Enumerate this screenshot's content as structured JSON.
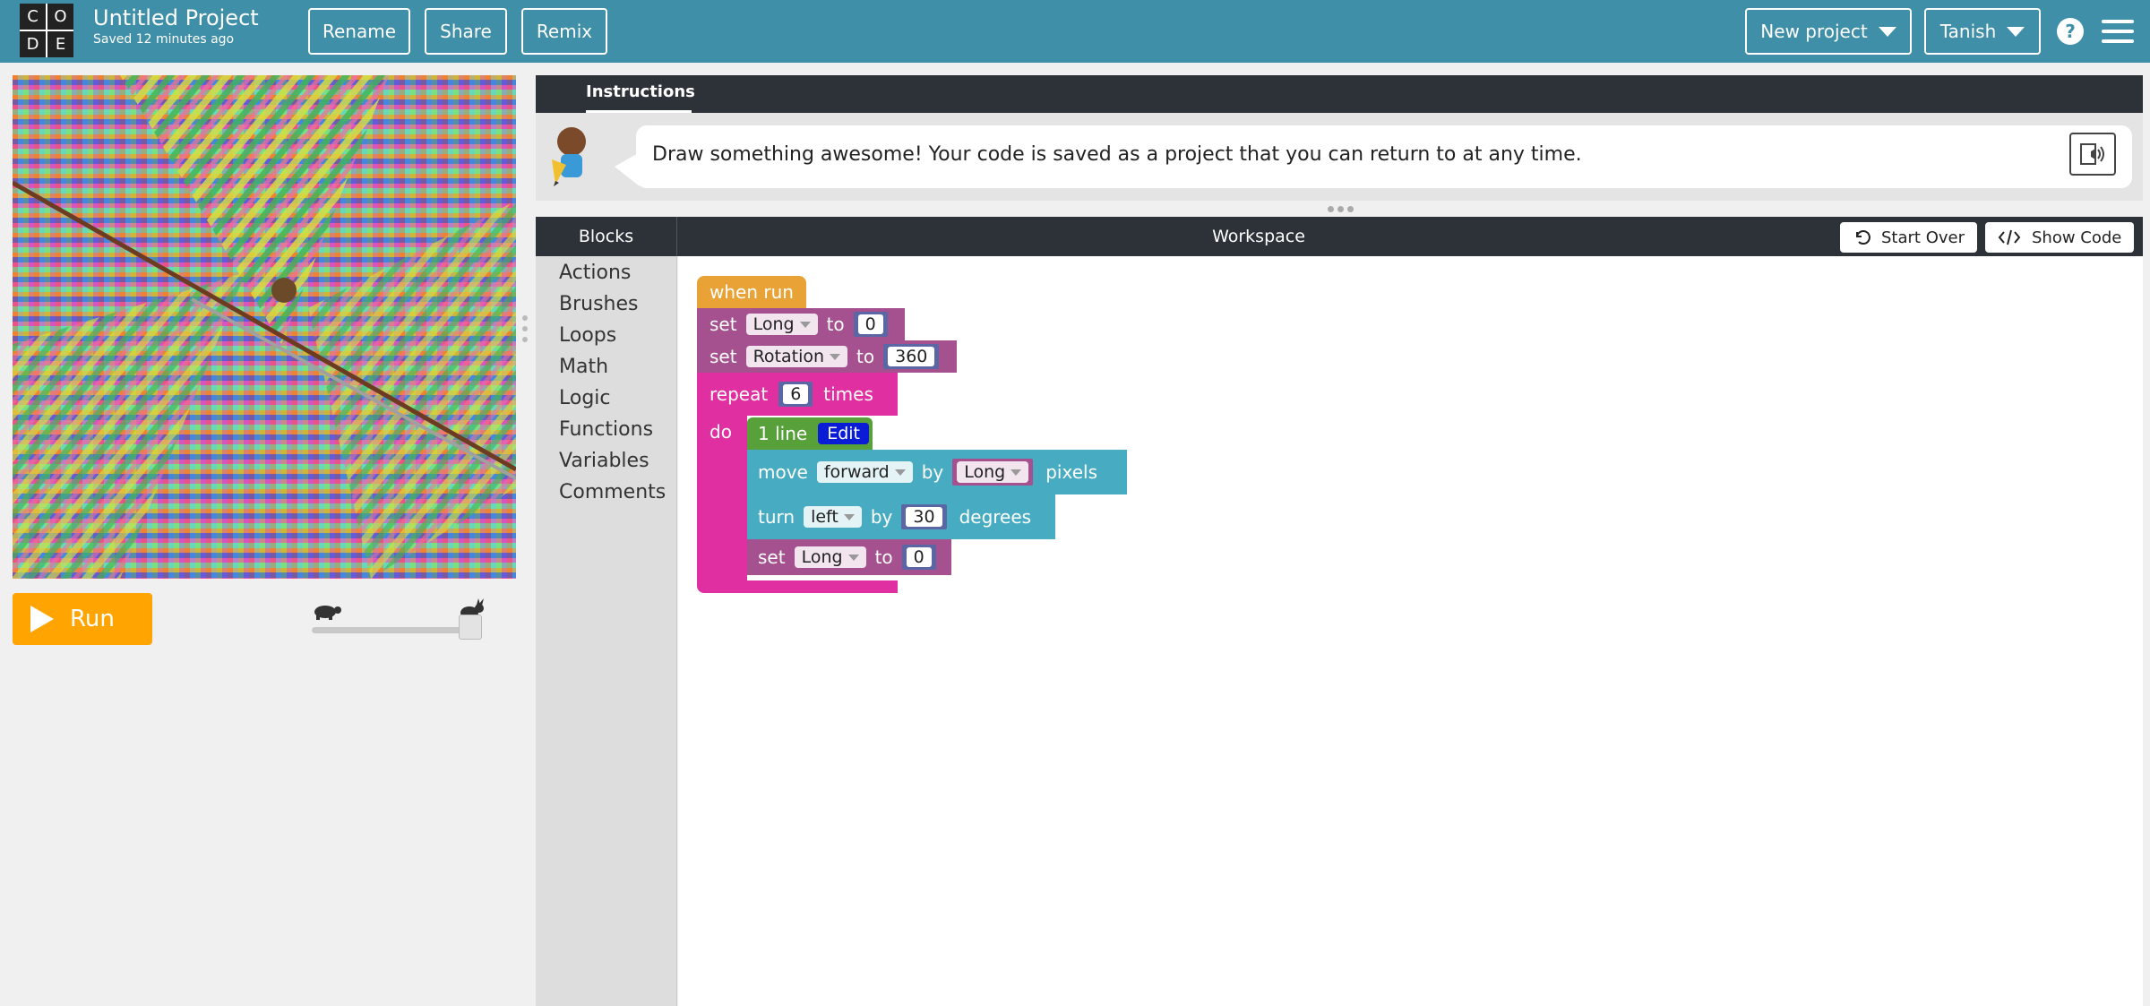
{
  "header": {
    "logo_letters": [
      "C",
      "O",
      "D",
      "E"
    ],
    "project_title": "Untitled Project",
    "saved_status": "Saved 12 minutes ago",
    "rename_label": "Rename",
    "share_label": "Share",
    "remix_label": "Remix",
    "new_project_label": "New project",
    "user_label": "Tanish",
    "help_label": "?",
    "color_bg": "#3f8fa8"
  },
  "left_panel": {
    "run_label": "Run",
    "run_color": "#ffa400",
    "speed_slider_fraction": 1.0
  },
  "instructions": {
    "tab_label": "Instructions",
    "text": "Draw something awesome! Your code is saved as a project that you can return to at any time."
  },
  "workspace": {
    "blocks_tab_label": "Blocks",
    "title": "Workspace",
    "start_over_label": "Start Over",
    "show_code_label": "Show Code",
    "categories": [
      "Actions",
      "Brushes",
      "Loops",
      "Math",
      "Logic",
      "Functions",
      "Variables",
      "Comments"
    ]
  },
  "code_blocks": {
    "when_run": "when run",
    "set_long": {
      "kw": "set",
      "var": "Long",
      "to": "to",
      "value": "0"
    },
    "set_rotation": {
      "kw": "set",
      "var": "Rotation",
      "to": "to",
      "value": "360"
    },
    "repeat": {
      "kw": "repeat",
      "count": "6",
      "suffix": "times",
      "do": "do"
    },
    "func": {
      "name": "1 line",
      "edit": "Edit"
    },
    "move": {
      "kw": "move",
      "dir": "forward",
      "by": "by",
      "var": "Long",
      "unit": "pixels"
    },
    "turn": {
      "kw": "turn",
      "dir": "left",
      "by": "by",
      "value": "30",
      "unit": "degrees"
    },
    "set_long2": {
      "kw": "set",
      "var": "Long",
      "to": "to",
      "value": "0"
    },
    "colors": {
      "event": "#e8a236",
      "variable": "#a5508f",
      "loop": "#e02fa0",
      "function": "#58a13a",
      "action": "#47acc1",
      "math": "#5b67a5"
    }
  }
}
